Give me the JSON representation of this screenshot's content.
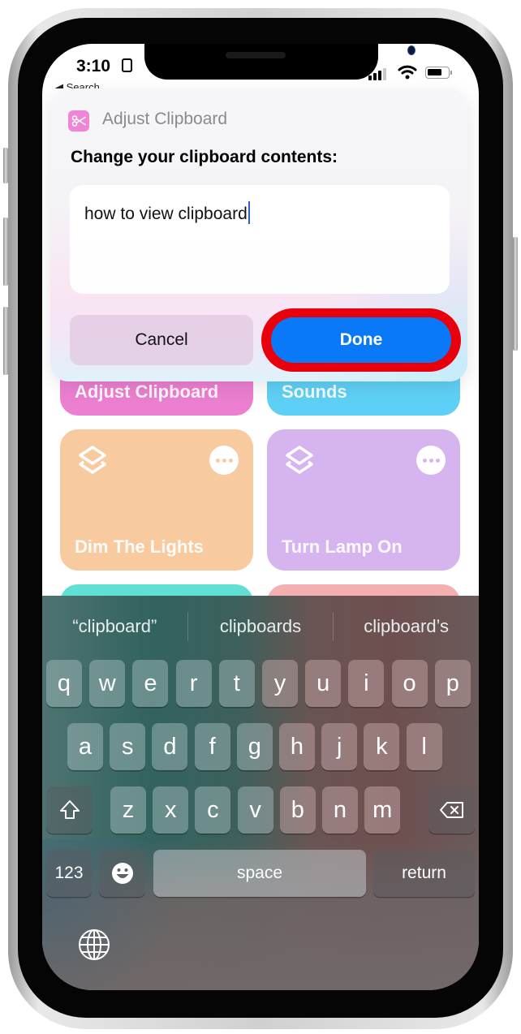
{
  "status_bar": {
    "time": "3:10",
    "back_label": "◀ Search"
  },
  "dialog": {
    "app_name": "Adjust Clipboard",
    "app_icon": "scissors-icon",
    "app_icon_color": "#ef85d6",
    "prompt": "Change your clipboard contents:",
    "text_value": "how to view clipboard",
    "cancel_label": "Cancel",
    "done_label": "Done",
    "done_color": "#0a79f8",
    "highlight_color": "#e8000c"
  },
  "shortcuts": [
    {
      "name": "Adjust Clipboard",
      "color": "#ec7fd0"
    },
    {
      "name": "Sounds",
      "color": "#5fd0f5"
    },
    {
      "name": "Dim The Lights",
      "color": "#f7caa0",
      "icon": "layers-icon"
    },
    {
      "name": "Turn Lamp On",
      "color": "#d6b4ef",
      "icon": "layers-icon"
    },
    {
      "name": "",
      "color": "#5fe0d2"
    },
    {
      "name": "",
      "color": "#f4b0b0"
    }
  ],
  "keyboard": {
    "suggestions": [
      "“clipboard”",
      "clipboards",
      "clipboard’s"
    ],
    "row1": [
      "q",
      "w",
      "e",
      "r",
      "t",
      "y",
      "u",
      "i",
      "o",
      "p"
    ],
    "row2": [
      "a",
      "s",
      "d",
      "f",
      "g",
      "h",
      "j",
      "k",
      "l"
    ],
    "row3": [
      "z",
      "x",
      "c",
      "v",
      "b",
      "n",
      "m"
    ],
    "numbers_label": "123",
    "space_label": "space",
    "return_label": "return"
  }
}
